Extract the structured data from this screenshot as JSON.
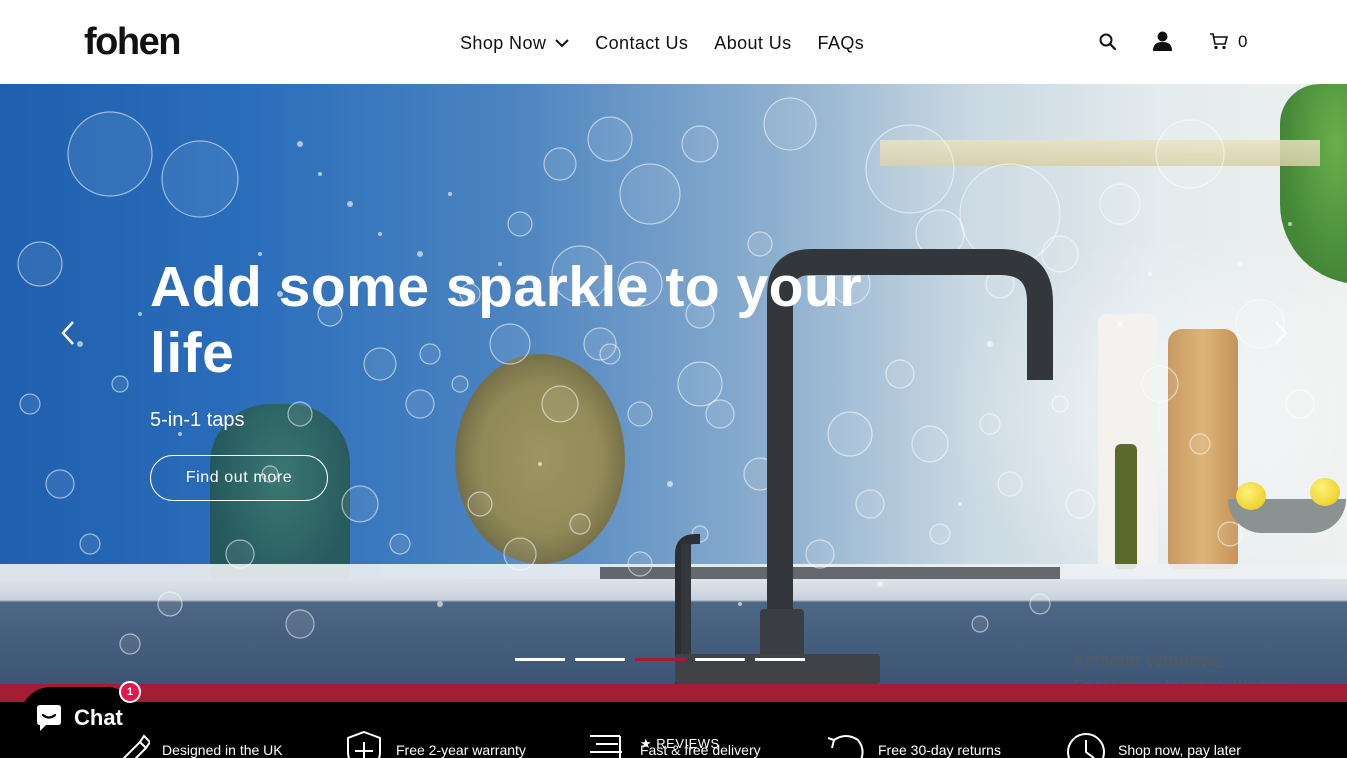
{
  "header": {
    "logo": "fohen",
    "nav": [
      {
        "label": "Shop Now",
        "has_dropdown": true
      },
      {
        "label": "Contact Us"
      },
      {
        "label": "About Us"
      },
      {
        "label": "FAQs"
      }
    ],
    "cart_count": "0",
    "icons": [
      "search-icon",
      "account-icon",
      "cart-icon"
    ]
  },
  "hero": {
    "title": "Add some sparkle to your life",
    "subtitle": "5-in-1 taps",
    "cta_label": "Find out more",
    "slides_count": 5,
    "active_slide": 3
  },
  "watermark": {
    "title": "Activate Windows",
    "subtitle": "Go to Settings to activate Windows."
  },
  "usp": [
    {
      "label": "Designed in the UK",
      "icon": "pen-icon"
    },
    {
      "label": "Free 2-year warranty",
      "icon": "shield-plus-icon"
    },
    {
      "label": "Fast & free delivery",
      "icon": "delivery-icon"
    },
    {
      "label": "Free 30-day returns",
      "icon": "returns-icon"
    },
    {
      "label": "Shop now, pay later",
      "icon": "clock-icon"
    }
  ],
  "reviews_tab": "★ REVIEWS",
  "chat": {
    "label": "Chat",
    "badge": "1"
  },
  "colors": {
    "accent": "#a31d35",
    "header_bg": "#ffffff",
    "usp_bg": "#000000",
    "chat_badge": "#e4154b"
  }
}
